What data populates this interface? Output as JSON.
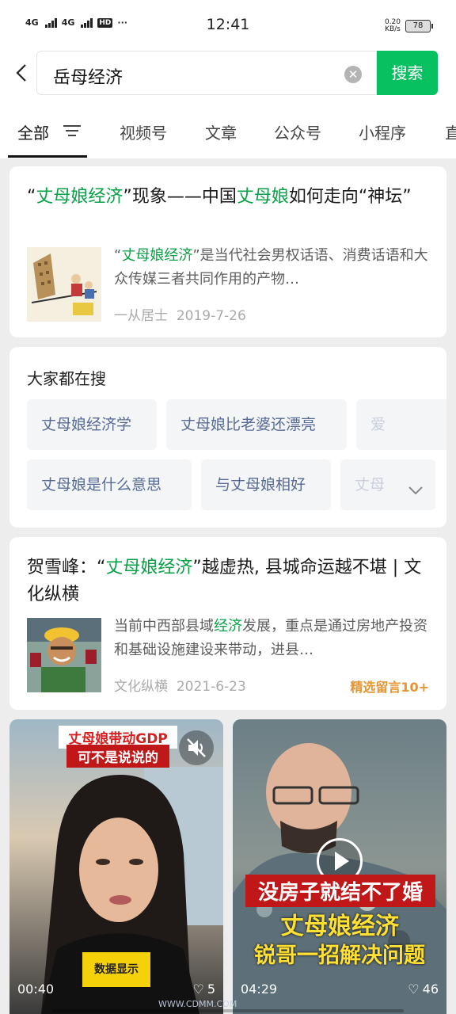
{
  "status_bar": {
    "net1": "4G",
    "net2": "4G",
    "hd": "HD",
    "dots": "···",
    "time": "12:41",
    "speed_value": "0.20",
    "speed_unit": "KB/s",
    "battery": "78"
  },
  "search": {
    "query": "岳母经济",
    "button": "搜索"
  },
  "tabs": [
    "全部",
    "视频号",
    "文章",
    "公众号",
    "小程序",
    "直"
  ],
  "result1": {
    "title_q1": "“",
    "title_hl1": "丈母娘经济",
    "title_mid": "”现象——中国",
    "title_hl2": "丈母娘",
    "title_end": "如何走向“神坛”",
    "snippet_q1": "“",
    "snippet_hl": "丈母娘经济",
    "snippet_rest": "”是当代社会男权话语、消费话语和大众传媒三者共同作用的产物…",
    "source": "一从居士",
    "date": "2019-7-26"
  },
  "hot": {
    "title": "大家都在搜",
    "chips": [
      "丈母娘经济学",
      "丈母娘比老婆还漂亮",
      "爱",
      "丈母娘是什么意思",
      "与丈母娘相好",
      "丈母"
    ]
  },
  "result2": {
    "title_pre": "贺雪峰：“",
    "title_hl": "丈母娘经济",
    "title_end": "”越虚热, 县城命运越不堪 | 文化纵横",
    "snippet_pre": "当前中西部县域",
    "snippet_hl": "经济",
    "snippet_rest": "发展，重点是通过房地产投资和基础设施建设来带动，进县…",
    "source": "文化纵横",
    "date": "2021-6-23",
    "badge": "精选留言10+"
  },
  "videos": [
    {
      "caption1": "丈母娘带动GDP",
      "caption2": "可不是说说的",
      "tag": "数据显示",
      "duration": "00:40",
      "likes": "5"
    },
    {
      "caption1": "没房子就结不了婚",
      "caption2": "丈母娘经济",
      "caption3": "锐哥一招解决问题",
      "duration": "04:29",
      "likes": "46"
    }
  ],
  "watermark": "WWW.CDMM.COM",
  "colors": {
    "accent": "#07c160",
    "highlight": "#07a044",
    "link": "#576b95",
    "badge": "#e6942f"
  }
}
